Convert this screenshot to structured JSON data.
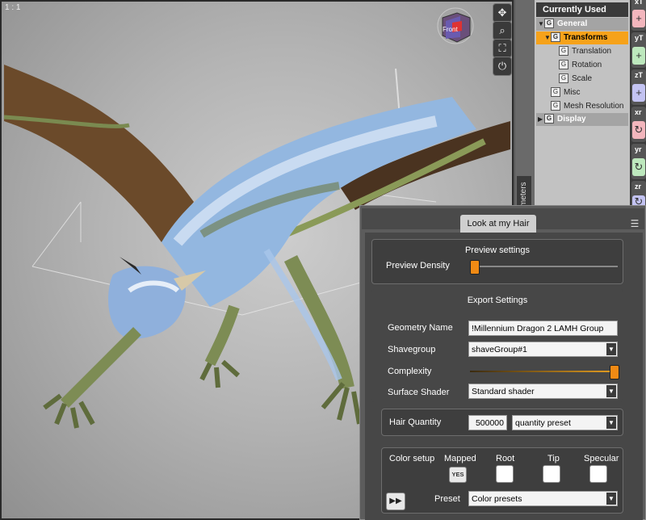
{
  "viewport": {
    "label": "1 : 1",
    "nav_cube_label": "Front",
    "nav_icons": [
      "move-view-icon",
      "zoom-view-icon",
      "frame-view-icon",
      "reset-view-icon"
    ]
  },
  "tree": {
    "header": "Currently Used",
    "items": [
      {
        "label": "General",
        "kind": "group",
        "expanded": true
      },
      {
        "label": "Transforms",
        "kind": "selected",
        "expanded": true
      },
      {
        "label": "Translation",
        "kind": "child"
      },
      {
        "label": "Rotation",
        "kind": "child"
      },
      {
        "label": "Scale",
        "kind": "child"
      },
      {
        "label": "Misc",
        "kind": "sub"
      },
      {
        "label": "Mesh Resolution",
        "kind": "sub"
      },
      {
        "label": "Display",
        "kind": "group",
        "expanded": false
      }
    ],
    "side_tab": "meters"
  },
  "tools": [
    {
      "label": "xT",
      "color": "#f3b6bd",
      "icon": "+"
    },
    {
      "label": "yT",
      "color": "#bde8bd",
      "icon": "+"
    },
    {
      "label": "zT",
      "color": "#c3c3f2",
      "icon": "+"
    },
    {
      "label": "xr",
      "color": "#f3b6bd",
      "icon": "↻"
    },
    {
      "label": "yr",
      "color": "#bde8bd",
      "icon": "↻"
    },
    {
      "label": "zr",
      "color": "#c3c3f2",
      "icon": "↻"
    }
  ],
  "dialog": {
    "tab_label": "Look at my Hair",
    "preview": {
      "title": "Preview settings",
      "density_label": "Preview Density",
      "density_level": 0.0
    },
    "export": {
      "title": "Export Settings",
      "geometry_label": "Geometry Name",
      "geometry_value": "!Millennium Dragon 2 LAMH Group",
      "shavegroup_label": "Shavegroup",
      "shavegroup_value": "shaveGroup#1",
      "complexity_label": "Complexity",
      "complexity_level": 1.0,
      "shader_label": "Surface Shader",
      "shader_value": "Standard shader"
    },
    "quantity": {
      "label": "Hair Quantity",
      "value": "500000",
      "preset_value": "quantity preset"
    },
    "color": {
      "title": "Color setup",
      "mapped_label": "Mapped",
      "mapped_button": "YES",
      "root_label": "Root",
      "tip_label": "Tip",
      "specular_label": "Specular",
      "preset_label": "Preset",
      "preset_value": "Color presets"
    }
  }
}
